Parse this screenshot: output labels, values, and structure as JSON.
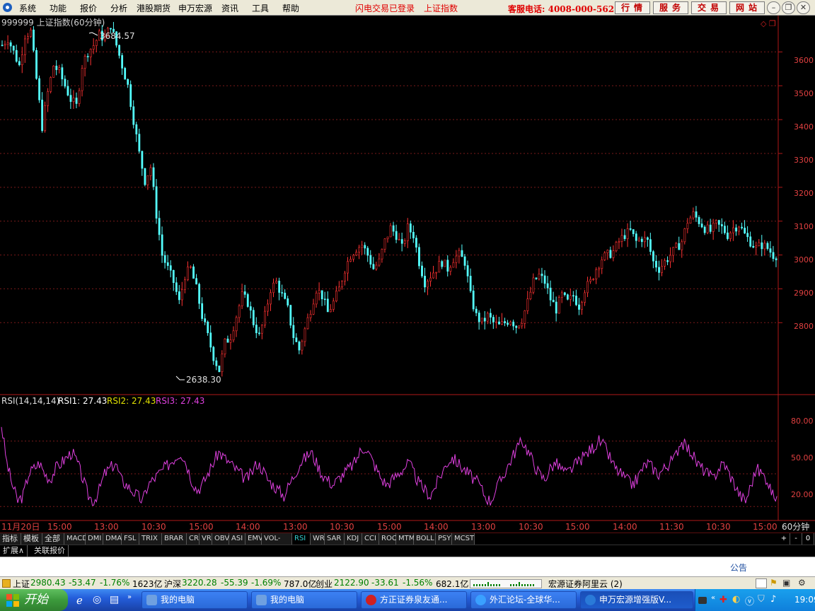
{
  "menu": {
    "items": [
      "系统",
      "功能",
      "报价",
      "分析",
      "港股期货",
      "申万宏源",
      "资讯",
      "工具",
      "帮助"
    ],
    "status_login": "闪电交易已登录",
    "status_index": "上证指数",
    "hotline": "客服电话: 4008-000-562",
    "right_buttons": [
      "行情",
      "服务",
      "交易",
      "网站"
    ]
  },
  "chart": {
    "title": "999999 上证指数(60分钟)",
    "high_label": "3684.57",
    "low_label": "2638.30",
    "price_ticks": [
      "3600",
      "3500",
      "3400",
      "3300",
      "3200",
      "3100",
      "3000",
      "2900",
      "2800"
    ],
    "time_labels": [
      "11月20日",
      "15:00",
      "13:00",
      "10:30",
      "15:00",
      "14:00",
      "13:00",
      "10:30",
      "15:00",
      "14:00",
      "13:00",
      "10:30",
      "15:00",
      "14:00",
      "11:30",
      "10:30",
      "15:00"
    ],
    "period_label": "60分钟"
  },
  "rsi": {
    "title": "RSI(14,14,14)",
    "rsi1": "RSI1: 27.43",
    "rsi2": "RSI2: 27.43",
    "rsi3": "RSI3: 27.43",
    "ticks": [
      "80.00",
      "50.00",
      "20.00"
    ]
  },
  "indicator_tabs": [
    "指标",
    "模板",
    "全部",
    "MACD",
    "DMI",
    "DMA",
    "FSL",
    "TRIX",
    "BRAR",
    "CR",
    "VR",
    "OBV",
    "ASI",
    "EMV",
    "VOL-TDX",
    "RSI",
    "WR",
    "SAR",
    "KDJ",
    "CCI",
    "ROC",
    "MTM",
    "BOLL",
    "PSY",
    "MCST"
  ],
  "active_tab": "RSI",
  "tab_controls": [
    "+",
    "-",
    "0"
  ],
  "sub_tabs": [
    "扩展∧",
    "关联报价"
  ],
  "notice_label": "公告",
  "status_bar": {
    "sh_name": "上证",
    "sh_value": "2980.43",
    "sh_change": "-53.47",
    "sh_pct": "-1.76%",
    "sh_amount": "1623亿",
    "hs_name": "沪深",
    "hs_value": "3220.28",
    "hs_change": "-55.39",
    "hs_pct": "-1.69%",
    "hs_amount": "787.0亿",
    "cy_name": "创业",
    "cy_value": "2122.90",
    "cy_change": "-33.61",
    "cy_pct": "-1.56%",
    "cy_amount": "682.1亿",
    "server": "宏源证券阿里云 (2)"
  },
  "taskbar": {
    "start_label": "开始",
    "tasks": [
      "我的电脑",
      "我的电脑",
      "方正证券泉友通...",
      "外汇论坛-全球华...",
      "申万宏源增强版V..."
    ],
    "clock": "19:09"
  },
  "chart_data": {
    "type": "candlestick",
    "title": "999999 上证指数(60分钟)",
    "ylim": [
      2600,
      3720
    ],
    "price_ticks": [
      3600,
      3500,
      3400,
      3300,
      3200,
      3100,
      3000,
      2900,
      2800
    ],
    "annotations": [
      {
        "label": "3684.57",
        "value": 3684.57
      },
      {
        "label": "2638.30",
        "value": 2638.3
      }
    ],
    "close_trend": [
      3620,
      3640,
      3600,
      3560,
      3650,
      3660,
      3520,
      3380,
      3480,
      3560,
      3540,
      3500,
      3460,
      3440,
      3560,
      3600,
      3620,
      3650,
      3640,
      3680,
      3620,
      3560,
      3500,
      3400,
      3300,
      3220,
      3260,
      3120,
      3000,
      2960,
      2920,
      2860,
      2940,
      2960,
      2900,
      2820,
      2760,
      2700,
      2660,
      2740,
      2760,
      2820,
      2880,
      2860,
      2800,
      2760,
      2820,
      2900,
      2920,
      2880,
      2840,
      2760,
      2720,
      2780,
      2840,
      2900,
      2880,
      2830,
      2860,
      2900,
      2960,
      3000,
      3020,
      3030,
      3000,
      2960,
      2980,
      3040,
      3080,
      3060,
      3020,
      3080,
      3060,
      2980,
      2920,
      2940,
      2960,
      2980,
      2960,
      2990,
      3000,
      2980,
      2880,
      2820,
      2800,
      2820,
      2800,
      2790,
      2800,
      2810,
      2790,
      2810,
      2860,
      2920,
      2940,
      2920,
      2870,
      2840,
      2880,
      2860,
      2880,
      2850,
      2900,
      2920,
      2960,
      2990,
      3000,
      3010,
      3040,
      3060,
      3070,
      3040,
      3050,
      3040,
      2980,
      2960,
      2980,
      3000,
      3020,
      3040,
      3100,
      3120,
      3100,
      3080,
      3070,
      3090,
      3080,
      3060,
      3080,
      3090,
      3060,
      3040,
      3020,
      3030,
      3020,
      3000
    ]
  },
  "rsi_series": [
    95,
    60,
    40,
    25,
    30,
    50,
    55,
    60,
    50,
    45,
    55,
    60,
    65,
    70,
    60,
    45,
    30,
    25,
    35,
    50,
    55,
    60,
    45,
    40,
    35,
    30,
    25,
    40,
    45,
    50,
    55,
    60,
    65,
    70,
    60,
    45,
    35,
    40,
    50,
    60,
    70,
    65,
    60,
    55,
    50,
    45,
    50,
    60,
    55,
    45,
    40,
    35,
    30,
    40,
    50,
    60,
    65,
    70,
    60,
    50,
    45,
    40,
    45,
    50,
    55,
    60,
    70,
    75,
    65,
    55,
    45,
    40,
    45,
    50,
    55,
    60,
    50,
    40,
    35,
    30,
    40,
    50,
    60,
    65,
    60,
    55,
    50,
    45,
    40,
    30,
    25,
    35,
    45,
    55,
    65,
    75,
    80,
    70,
    60,
    50,
    45,
    55,
    60,
    55,
    50,
    55,
    60,
    65,
    70,
    75,
    80,
    75,
    65,
    55,
    50,
    45,
    40,
    45,
    55,
    60,
    55,
    50,
    55,
    60,
    65,
    80,
    75,
    70,
    60,
    55,
    50,
    45,
    55,
    60,
    50,
    40,
    30,
    25,
    40,
    55,
    50,
    45,
    30
  ]
}
